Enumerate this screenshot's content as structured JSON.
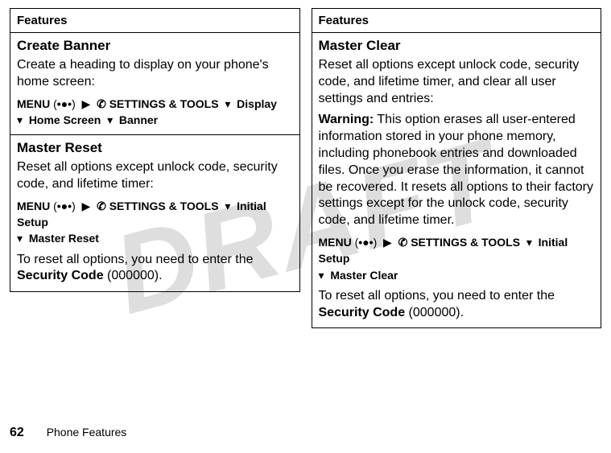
{
  "watermark": "DRAFT",
  "left": {
    "header": "Features",
    "section1": {
      "title": "Create Banner",
      "desc": "Create a heading to display on your phone's home screen:",
      "path": {
        "menu": "MENU",
        "paren_open": "(",
        "center_glyph": "•●•",
        "paren_close": ")",
        "arrow1": "▶",
        "tools_glyph": "✆",
        "tools": "SETTINGS & TOOLS",
        "d1": "▾",
        "opt1": "Display",
        "d2": "▾",
        "opt2": "Home Screen",
        "d3": "▾",
        "opt3": "Banner"
      }
    },
    "section2": {
      "title": "Master Reset",
      "desc": "Reset all options except unlock code, security code, and lifetime timer:",
      "path": {
        "menu": "MENU",
        "paren_open": "(",
        "center_glyph": "•●•",
        "paren_close": ")",
        "arrow1": "▶",
        "tools_glyph": "✆",
        "tools": "SETTINGS & TOOLS",
        "d1": "▾",
        "opt1": "Initial Setup",
        "d2": "▾",
        "opt2": "Master Reset"
      },
      "note_prefix": "To reset all options, you need to enter the ",
      "note_bold": "Security Code",
      "note_suffix": " (000000)."
    }
  },
  "right": {
    "header": "Features",
    "section1": {
      "title": "Master Clear",
      "desc": "Reset all options except unlock code, security code, and lifetime timer, and clear all user settings and entries:",
      "warning_label": "Warning:",
      "warning_text": " This option erases all user-entered information stored in your phone memory, including phonebook entries and downloaded files. Once you erase the information, it cannot be recovered. It resets all options to their factory settings except for the unlock code, security code, and lifetime timer.",
      "path": {
        "menu": "MENU",
        "paren_open": "(",
        "center_glyph": "•●•",
        "paren_close": ")",
        "arrow1": "▶",
        "tools_glyph": "✆",
        "tools": "SETTINGS & TOOLS",
        "d1": "▾",
        "opt1": "Initial Setup",
        "d2": "▾",
        "opt2": "Master Clear"
      },
      "note_prefix": "To reset all options, you need to enter the ",
      "note_bold": "Security Code",
      "note_suffix": " (000000)."
    }
  },
  "footer": {
    "page": "62",
    "label": "Phone Features"
  }
}
